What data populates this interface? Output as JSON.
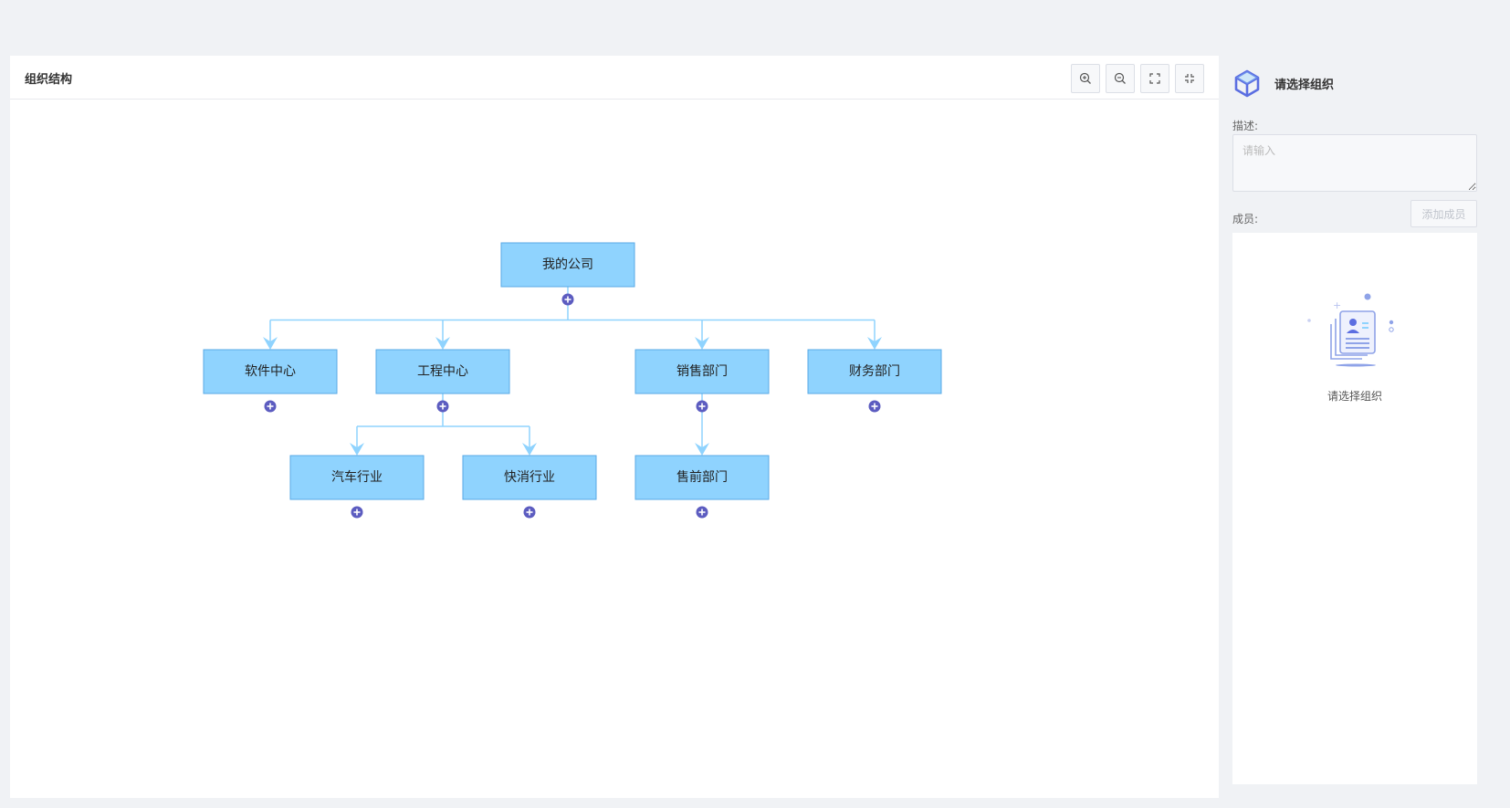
{
  "header": {
    "title": "组织结构",
    "tools": [
      {
        "name": "zoom-in",
        "icon": "zoom-in-icon"
      },
      {
        "name": "zoom-out",
        "icon": "zoom-out-icon"
      },
      {
        "name": "fit",
        "icon": "fit-screen-icon"
      },
      {
        "name": "collapse",
        "icon": "collapse-icon"
      }
    ]
  },
  "org_chart": {
    "nodes": [
      {
        "id": "root",
        "label": "我的公司",
        "parent": null
      },
      {
        "id": "n1",
        "label": "软件中心",
        "parent": "root"
      },
      {
        "id": "n2",
        "label": "工程中心",
        "parent": "root"
      },
      {
        "id": "n3",
        "label": "销售部门",
        "parent": "root"
      },
      {
        "id": "n4",
        "label": "财务部门",
        "parent": "root"
      },
      {
        "id": "n5",
        "label": "汽车行业",
        "parent": "n2"
      },
      {
        "id": "n6",
        "label": "快消行业",
        "parent": "n2"
      },
      {
        "id": "n7",
        "label": "售前部门",
        "parent": "n3"
      }
    ],
    "colors": {
      "node_fill": "#8fd3fe",
      "node_stroke": "#5aa9e6",
      "edge": "#8fd3fe",
      "add_button": "#5c5cc0"
    }
  },
  "side": {
    "icon": "cube-icon",
    "title": "请选择组织",
    "desc_label": "描述:",
    "desc_placeholder": "请输入",
    "member_label": "成员:",
    "add_member_label": "添加成员",
    "empty_text": "请选择组织",
    "empty_icon": "contact-card-icon"
  }
}
